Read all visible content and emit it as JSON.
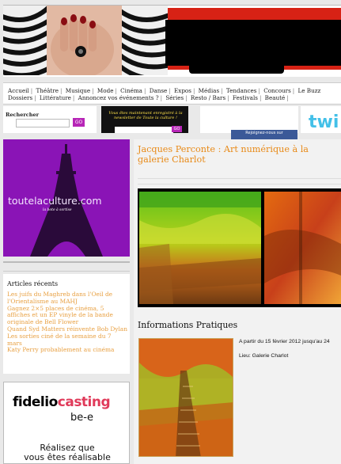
{
  "nav": {
    "row1": [
      "Accueil",
      "Théâtre",
      "Musique",
      "Mode",
      "Cinéma",
      "Danse",
      "Expos",
      "Médias",
      "Tendances",
      "Concours",
      "Le Buzz"
    ],
    "row2": [
      "Dossiers",
      "Littérature",
      "Annoncez vos événements ?",
      "Séries",
      "Resto / Bars",
      "Festivals",
      "Beauté"
    ]
  },
  "search": {
    "label": "Rechercher",
    "placeholder": "",
    "button": "GO"
  },
  "newsletter": {
    "text": "Vous êtes maintenant enregistré à la newsletter de Toute la culture !",
    "button": "GO"
  },
  "facebook": {
    "label": "Rejoignez-nous sur"
  },
  "logo": {
    "text": "toutelaculture.com",
    "tagline": "la bote à sortise"
  },
  "articles": {
    "title": "Articles récents",
    "items": [
      "Les juifs du Maghreb dans l'Oeil de l'Orientalisme au MAHJ",
      "Gagnez 2×5 places de cinéma, 5 affiches et un EP vinyle de la bande originale de Bell Flower",
      "Quand Syd Matters réinvente Bob Dylan",
      "Les sorties ciné de la semaine du 7 mars",
      "Katy Perry probablement au cinéma"
    ]
  },
  "ad": {
    "brand_a": "fidelio",
    "brand_b": "casting",
    "sub": "be-e",
    "line1": "Réalisez que",
    "line2": "vous êtes réalisable"
  },
  "post": {
    "title": "Jacques Perconte : Art numérique à la galerie Charlot",
    "info_title": "Informations Pratiques",
    "date": "A partir du 15 février 2012 jusqu'au 24",
    "place": "Lieu: Galerie Charlot"
  },
  "colors": {
    "accent_orange": "#e88a18",
    "purple": "#8a14b6",
    "button_purple": "#b726b7",
    "banner_red": "#d72215"
  }
}
